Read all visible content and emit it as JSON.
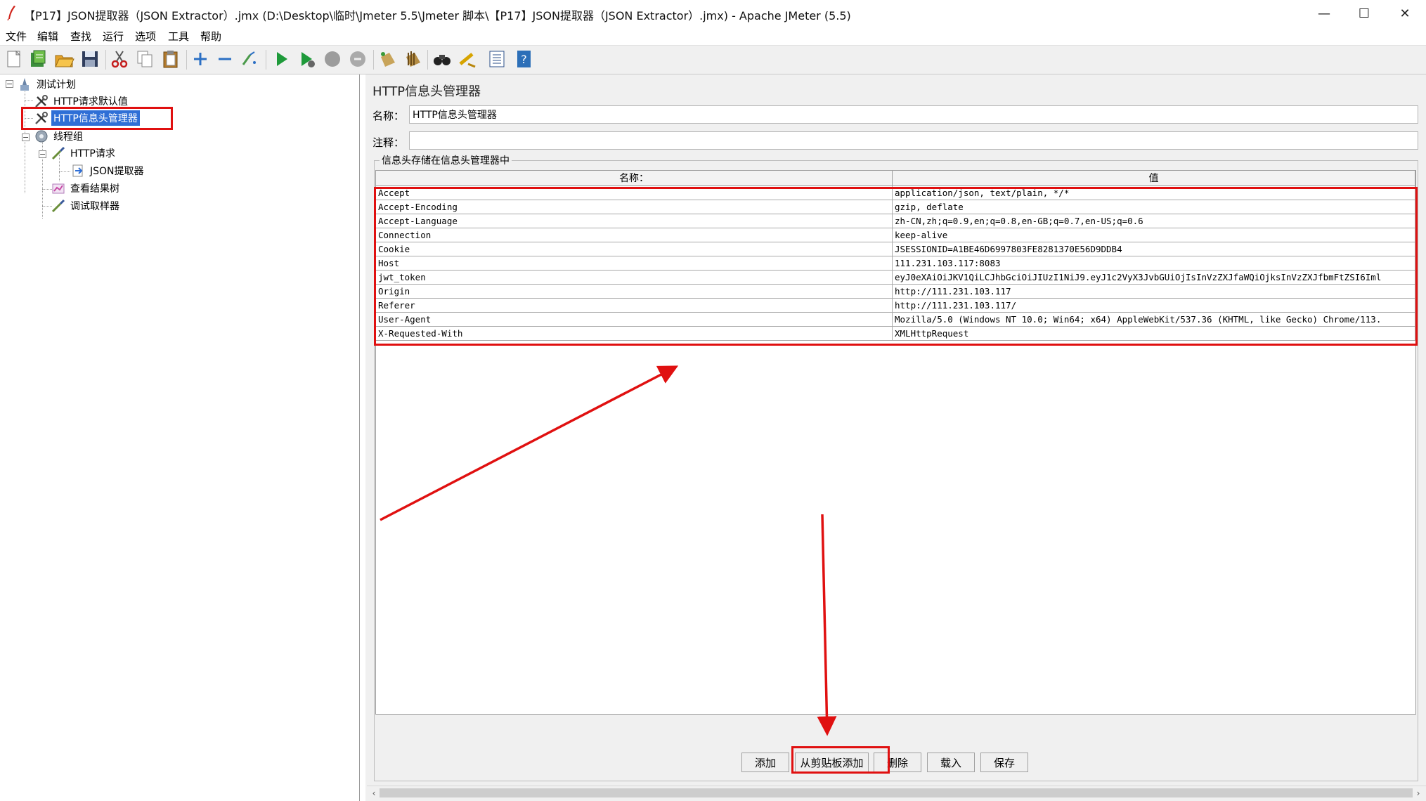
{
  "window": {
    "title": "【P17】JSON提取器（JSON Extractor）.jmx (D:\\Desktop\\临时\\Jmeter 5.5\\Jmeter 脚本\\【P17】JSON提取器（JSON Extractor）.jmx) - Apache JMeter (5.5)",
    "minimize": "—",
    "maximize": "☐",
    "close": "✕"
  },
  "menu": [
    "文件",
    "编辑",
    "查找",
    "运行",
    "选项",
    "工具",
    "帮助"
  ],
  "toolbar": [
    "new-icon",
    "templates-icon",
    "open-icon",
    "save-icon",
    "cut-icon",
    "copy-icon",
    "paste-icon",
    "expand-icon",
    "collapse-icon",
    "toggle-icon",
    "start-icon",
    "start-no-pause-icon",
    "stop-icon",
    "shutdown-icon",
    "clear-icon",
    "clear-all-icon",
    "search-icon",
    "reset-search-icon",
    "function-helper-icon",
    "help-icon"
  ],
  "tree": {
    "items": [
      {
        "label": "测试计划"
      },
      {
        "label": "HTTP请求默认值"
      },
      {
        "label": "HTTP信息头管理器",
        "selected": true
      },
      {
        "label": "线程组"
      },
      {
        "label": "HTTP请求"
      },
      {
        "label": "JSON提取器"
      },
      {
        "label": "查看结果树"
      },
      {
        "label": "调试取样器"
      }
    ]
  },
  "panel": {
    "title": "HTTP信息头管理器",
    "name_label": "名称：",
    "name_value": "HTTP信息头管理器",
    "comment_label": "注释：",
    "comment_value": "",
    "group_label": "信息头存储在信息头管理器中",
    "table": {
      "columns": [
        "名称：",
        "值"
      ],
      "rows": [
        [
          "Accept",
          "application/json, text/plain, */*"
        ],
        [
          "Accept-Encoding",
          "gzip, deflate"
        ],
        [
          "Accept-Language",
          "zh-CN,zh;q=0.9,en;q=0.8,en-GB;q=0.7,en-US;q=0.6"
        ],
        [
          "Connection",
          "keep-alive"
        ],
        [
          "Cookie",
          "JSESSIONID=A1BE46D6997803FE8281370E56D9DDB4"
        ],
        [
          "Host",
          "111.231.103.117:8083"
        ],
        [
          "jwt_token",
          "eyJ0eXAiOiJKV1QiLCJhbGciOiJIUzI1NiJ9.eyJ1c2VyX3JvbGUiOjIsInVzZXJfaWQiOjksInVzZXJfbmFtZSI6Iml"
        ],
        [
          "Origin",
          "http://111.231.103.117"
        ],
        [
          "Referer",
          "http://111.231.103.117/"
        ],
        [
          "User-Agent",
          "Mozilla/5.0 (Windows NT 10.0; Win64; x64) AppleWebKit/537.36 (KHTML, like Gecko) Chrome/113."
        ],
        [
          "X-Requested-With",
          "XMLHttpRequest"
        ]
      ]
    },
    "buttons": [
      "添加",
      "从剪贴板添加",
      "删除",
      "载入",
      "保存"
    ]
  },
  "colors": {
    "annotation": "#e01010",
    "selection": "#2f6fd6"
  }
}
